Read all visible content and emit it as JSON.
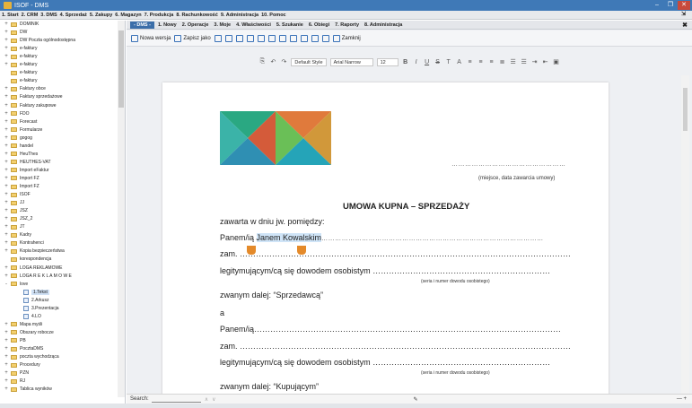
{
  "window": {
    "title": "ISOF - DMS",
    "minimize": "–",
    "maximize": "❐",
    "close": "✕"
  },
  "menu": [
    "1. Start",
    "2. CRM",
    "3. DMS",
    "4. Sprzedaż",
    "5. Zakupy",
    "6. Magazyn",
    "7. Produkcja",
    "8. Rachunkowość",
    "9. Administracja",
    "10. Pomoc"
  ],
  "modulebar": {
    "badge": "- DMS -",
    "items": [
      "1. Nowy",
      "2. Operacje",
      "3. Moje",
      "4. Właściwości",
      "5. Szukanie",
      "6. Obiegi",
      "7. Raporty",
      "8. Administracja"
    ],
    "close": "✖"
  },
  "toolbar": {
    "new_version": "Nowa wersja",
    "save_as": "Zapisz jako",
    "close": "Zamknij"
  },
  "format": {
    "style": "Default Style",
    "font": "Arial Narrow",
    "size": "12"
  },
  "tree": [
    {
      "exp": "+",
      "icon": "folder",
      "label": "DOMINIK"
    },
    {
      "exp": "+",
      "icon": "folder",
      "label": "DW"
    },
    {
      "exp": "+",
      "icon": "folder",
      "label": "DW Poczta ogólnodostępna"
    },
    {
      "exp": "+",
      "icon": "folder",
      "label": "e-faktury"
    },
    {
      "exp": "+",
      "icon": "folder",
      "label": "e-faktury"
    },
    {
      "exp": "+",
      "icon": "folder",
      "label": "e-faktury"
    },
    {
      "exp": "",
      "icon": "folder",
      "label": "e-faktury"
    },
    {
      "exp": "",
      "icon": "folder",
      "label": "e-faktury"
    },
    {
      "exp": "+",
      "icon": "folder",
      "label": "Faktury obce"
    },
    {
      "exp": "+",
      "icon": "folder",
      "label": "Faktury sprzedażowe"
    },
    {
      "exp": "+",
      "icon": "folder",
      "label": "Faktury zakupowe"
    },
    {
      "exp": "+",
      "icon": "folder",
      "label": "FDO"
    },
    {
      "exp": "+",
      "icon": "folder",
      "label": "Forecast"
    },
    {
      "exp": "+",
      "icon": "folder",
      "label": "Formularze"
    },
    {
      "exp": "+",
      "icon": "folder",
      "label": "gogog"
    },
    {
      "exp": "+",
      "icon": "folder",
      "label": "handel"
    },
    {
      "exp": "+",
      "icon": "folder",
      "label": "HeuThes"
    },
    {
      "exp": "+",
      "icon": "folder",
      "label": "HEUTHES-VAT"
    },
    {
      "exp": "+",
      "icon": "folder",
      "label": "Import eFaktur"
    },
    {
      "exp": "+",
      "icon": "folder",
      "label": "Import FZ"
    },
    {
      "exp": "+",
      "icon": "folder",
      "label": "Import FZ"
    },
    {
      "exp": "+",
      "icon": "folder",
      "label": "ISOF"
    },
    {
      "exp": "+",
      "icon": "folder",
      "label": "JJ"
    },
    {
      "exp": "+",
      "icon": "folder",
      "label": "JSZ"
    },
    {
      "exp": "+",
      "icon": "folder",
      "label": "JSZ_2"
    },
    {
      "exp": "+",
      "icon": "folder",
      "label": "JT"
    },
    {
      "exp": "+",
      "icon": "folder",
      "label": "Kadry"
    },
    {
      "exp": "+",
      "icon": "folder",
      "label": "Kontrahenci"
    },
    {
      "exp": "+",
      "icon": "folder",
      "label": "Kopia bezpieczeństwa"
    },
    {
      "exp": "",
      "icon": "folder",
      "label": "korespondencja"
    },
    {
      "exp": "+",
      "icon": "folder",
      "label": "LOGA REKLAMOWE"
    },
    {
      "exp": "+",
      "icon": "folder",
      "label": "LOGA R E K L A M O W E"
    },
    {
      "exp": "-",
      "icon": "folder",
      "label": "love"
    },
    {
      "exp": "",
      "icon": "doc",
      "label": "1.Tekst",
      "indent": 1,
      "selected": true
    },
    {
      "exp": "",
      "icon": "doc",
      "label": "2.Arkusz",
      "indent": 1
    },
    {
      "exp": "",
      "icon": "doc",
      "label": "3.Prezentacja",
      "indent": 1
    },
    {
      "exp": "",
      "icon": "doc",
      "label": "4.LO",
      "indent": 1
    },
    {
      "exp": "+",
      "icon": "folder",
      "label": "Mapa myśli"
    },
    {
      "exp": "+",
      "icon": "folder",
      "label": "Obszary robocze"
    },
    {
      "exp": "+",
      "icon": "folder",
      "label": "PB"
    },
    {
      "exp": "+",
      "icon": "folder",
      "label": "PocztaDMS"
    },
    {
      "exp": "+",
      "icon": "folder",
      "label": "poczta wychodząca"
    },
    {
      "exp": "+",
      "icon": "folder",
      "label": "Procedury"
    },
    {
      "exp": "+",
      "icon": "folder",
      "label": "PZN"
    },
    {
      "exp": "+",
      "icon": "folder",
      "label": "RJ"
    },
    {
      "exp": "+",
      "icon": "folder",
      "label": "Tablica wyników"
    }
  ],
  "doc": {
    "place_date_dots": "……………………………………………",
    "place_date_caption": "(miejsce, data zawarcia umowy)",
    "title": "UMOWA KUPNA – SPRZEDAŻY",
    "l1": "zawarta w dniu jw. pomiędzy:",
    "l2a": "Panem/ią ",
    "l2b": "Janem Kowalskim",
    "l2c": "………………………………………………………………………………………",
    "l3": "zam. ……………………………………………………………………………………………………………",
    "l4": "legitymującym/cą się dowodem osobistym …………………………………………………………",
    "l4cap": "(seria i numer dowodu osobistego)",
    "l5": "zwanym dalej: “Sprzedawcą”",
    "l6": "a",
    "l7": "Panem/ią……………………………………………………………………………………………………",
    "l8": "zam. ……………………………………………………………………………………………………………",
    "l9": "legitymującym/cą się dowodem osobistym …………………………………………………………",
    "l9cap": "(seria i numer dowodu osobistego)",
    "l10": "zwanym dalej: “Kupującym”"
  },
  "status": {
    "search_label": "Search:",
    "zoom": "— +"
  },
  "colors": {
    "titlebar": "#3f79b7",
    "accent": "#3b6ea9",
    "handle": "#e48a2a"
  }
}
